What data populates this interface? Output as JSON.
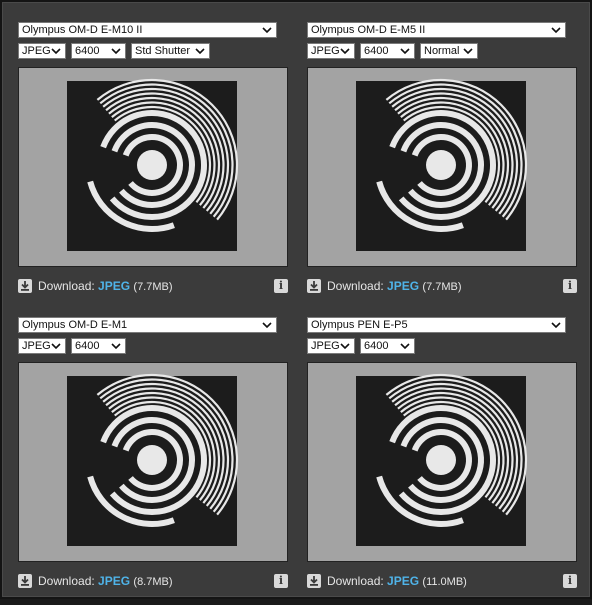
{
  "panels": [
    {
      "camera": "Olympus OM-D E-M10 II",
      "format": "JPEG",
      "iso": "6400",
      "mode": "Std Shutter",
      "download_label": "Download:",
      "download_format": "JPEG",
      "download_size": "(7.7MB)",
      "info": "i"
    },
    {
      "camera": "Olympus OM-D E-M5 II",
      "format": "JPEG",
      "iso": "6400",
      "mode": "Normal",
      "download_label": "Download:",
      "download_format": "JPEG",
      "download_size": "(7.7MB)",
      "info": "i"
    },
    {
      "camera": "Olympus OM-D E-M1",
      "format": "JPEG",
      "iso": "6400",
      "download_label": "Download:",
      "download_format": "JPEG",
      "download_size": "(8.7MB)",
      "info": "i"
    },
    {
      "camera": "Olympus PEN E-P5",
      "format": "JPEG",
      "iso": "6400",
      "download_label": "Download:",
      "download_format": "JPEG",
      "download_size": "(11.0MB)",
      "info": "i"
    }
  ],
  "icons": {
    "dropdown": "chevron-down-icon",
    "download": "download-icon",
    "info": "info-icon"
  },
  "colors": {
    "background": "#3b3b3b",
    "format_link": "#4fb3e8",
    "target_card": "#1c1c1c",
    "target_rings": "#e8e8e8"
  }
}
